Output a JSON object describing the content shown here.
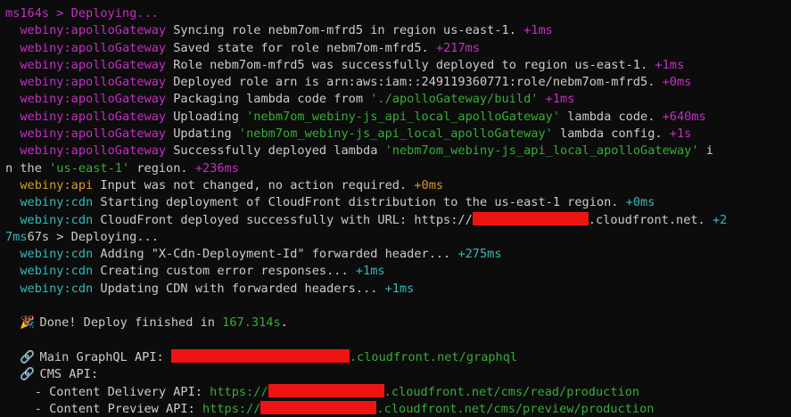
{
  "terminal": {
    "lines": [
      {
        "segments": [
          {
            "text": "ms164s > Deploying...",
            "class": "c-magenta"
          }
        ]
      },
      {
        "segments": [
          {
            "text": "  "
          },
          {
            "text": "webiny:apolloGateway",
            "class": "c-magenta"
          },
          {
            "text": " Syncing role nebm7om-mfrd5 in region us-east-1. ",
            "class": "c-default"
          },
          {
            "text": "+1ms",
            "class": "c-magenta"
          }
        ]
      },
      {
        "segments": [
          {
            "text": "  "
          },
          {
            "text": "webiny:apolloGateway",
            "class": "c-magenta"
          },
          {
            "text": " Saved state for role nebm7om-mfrd5. ",
            "class": "c-default"
          },
          {
            "text": "+217ms",
            "class": "c-magenta"
          }
        ]
      },
      {
        "segments": [
          {
            "text": "  "
          },
          {
            "text": "webiny:apolloGateway",
            "class": "c-magenta"
          },
          {
            "text": " Role nebm7om-mfrd5 was successfully deployed to region us-east-1. ",
            "class": "c-default"
          },
          {
            "text": "+1ms",
            "class": "c-magenta"
          }
        ]
      },
      {
        "segments": [
          {
            "text": "  "
          },
          {
            "text": "webiny:apolloGateway",
            "class": "c-magenta"
          },
          {
            "text": " Deployed role arn is arn:aws:iam::249119360771:role/nebm7om-mfrd5. ",
            "class": "c-default"
          },
          {
            "text": "+0ms",
            "class": "c-magenta"
          }
        ]
      },
      {
        "segments": [
          {
            "text": "  "
          },
          {
            "text": "webiny:apolloGateway",
            "class": "c-magenta"
          },
          {
            "text": " Packaging lambda code from ",
            "class": "c-default"
          },
          {
            "text": "'./apolloGateway/build'",
            "class": "c-green"
          },
          {
            "text": " ",
            "class": "c-default"
          },
          {
            "text": "+1ms",
            "class": "c-magenta"
          }
        ]
      },
      {
        "segments": [
          {
            "text": "  "
          },
          {
            "text": "webiny:apolloGateway",
            "class": "c-magenta"
          },
          {
            "text": " Uploading ",
            "class": "c-default"
          },
          {
            "text": "'nebm7om_webiny-js_api_local_apolloGateway'",
            "class": "c-green"
          },
          {
            "text": " lambda code. ",
            "class": "c-default"
          },
          {
            "text": "+640ms",
            "class": "c-magenta"
          }
        ]
      },
      {
        "segments": [
          {
            "text": "  "
          },
          {
            "text": "webiny:apolloGateway",
            "class": "c-magenta"
          },
          {
            "text": " Updating ",
            "class": "c-default"
          },
          {
            "text": "'nebm7om_webiny-js_api_local_apolloGateway'",
            "class": "c-green"
          },
          {
            "text": " lambda config. ",
            "class": "c-default"
          },
          {
            "text": "+1s",
            "class": "c-magenta"
          }
        ]
      },
      {
        "segments": [
          {
            "text": "  "
          },
          {
            "text": "webiny:apolloGateway",
            "class": "c-magenta"
          },
          {
            "text": " Successfully deployed lambda ",
            "class": "c-default"
          },
          {
            "text": "'nebm7om_webiny-js_api_local_apolloGateway'",
            "class": "c-green"
          },
          {
            "text": " i",
            "class": "c-default"
          }
        ]
      },
      {
        "segments": [
          {
            "text": "n the ",
            "class": "c-default"
          },
          {
            "text": "'us-east-1'",
            "class": "c-green"
          },
          {
            "text": " region. ",
            "class": "c-default"
          },
          {
            "text": "+236ms",
            "class": "c-magenta"
          }
        ]
      },
      {
        "segments": [
          {
            "text": "  "
          },
          {
            "text": "webiny:api",
            "class": "c-orange"
          },
          {
            "text": " Input was not changed, no action required. ",
            "class": "c-default"
          },
          {
            "text": "+0ms",
            "class": "c-orange"
          }
        ]
      },
      {
        "segments": [
          {
            "text": "  "
          },
          {
            "text": "webiny:cdn",
            "class": "c-teal"
          },
          {
            "text": " Starting deployment of CloudFront distribution to the us-east-1 region. ",
            "class": "c-default"
          },
          {
            "text": "+0ms",
            "class": "c-teal"
          }
        ]
      },
      {
        "segments": [
          {
            "text": "  "
          },
          {
            "text": "webiny:cdn",
            "class": "c-teal"
          },
          {
            "text": " CloudFront deployed successfully with URL: https://",
            "class": "c-default"
          },
          {
            "redact": true,
            "width": 130
          },
          {
            "text": ".cloudfront.net. ",
            "class": "c-default"
          },
          {
            "text": "+2",
            "class": "c-teal"
          }
        ]
      },
      {
        "segments": [
          {
            "text": "7ms",
            "class": "c-teal"
          },
          {
            "text": "67s > Deploying...",
            "class": "c-default"
          }
        ]
      },
      {
        "segments": [
          {
            "text": "  "
          },
          {
            "text": "webiny:cdn",
            "class": "c-teal"
          },
          {
            "text": " Adding \"X-Cdn-Deployment-Id\" forwarded header... ",
            "class": "c-default"
          },
          {
            "text": "+275ms",
            "class": "c-teal"
          }
        ]
      },
      {
        "segments": [
          {
            "text": "  "
          },
          {
            "text": "webiny:cdn",
            "class": "c-teal"
          },
          {
            "text": " Creating custom error responses... ",
            "class": "c-default"
          },
          {
            "text": "+1ms",
            "class": "c-teal"
          }
        ]
      },
      {
        "segments": [
          {
            "text": "  "
          },
          {
            "text": "webiny:cdn",
            "class": "c-teal"
          },
          {
            "text": " Updating CDN with forwarded headers... ",
            "class": "c-default"
          },
          {
            "text": "+1ms",
            "class": "c-teal"
          }
        ]
      },
      {
        "segments": []
      },
      {
        "segments": [
          {
            "text": "  "
          },
          {
            "icon": "party-popper-icon",
            "glyph": "🎉"
          },
          {
            "text": " Done! Deploy finished in ",
            "class": "c-default"
          },
          {
            "text": "167.314s",
            "class": "c-green"
          },
          {
            "text": ".",
            "class": "c-default"
          }
        ]
      },
      {
        "segments": []
      },
      {
        "segments": [
          {
            "text": "  "
          },
          {
            "icon": "link-icon",
            "glyph": "🔗"
          },
          {
            "text": " Main GraphQL API: ",
            "class": "c-default"
          },
          {
            "redact": true,
            "width": 200
          },
          {
            "text": ".cloudfront.net/graphql",
            "class": "c-green"
          }
        ]
      },
      {
        "segments": [
          {
            "text": "  "
          },
          {
            "icon": "link-icon",
            "glyph": "🔗"
          },
          {
            "text": " CMS API:",
            "class": "c-default"
          }
        ]
      },
      {
        "segments": [
          {
            "text": "    - Content Delivery API: ",
            "class": "c-default"
          },
          {
            "text": "https://",
            "class": "c-green"
          },
          {
            "redact": true,
            "width": 130
          },
          {
            "text": ".cloudfront.net/cms/read/production",
            "class": "c-green"
          }
        ]
      },
      {
        "segments": [
          {
            "text": "    - Content Preview API: ",
            "class": "c-default"
          },
          {
            "text": "https://",
            "class": "c-green"
          },
          {
            "redact": true,
            "width": 130
          },
          {
            "text": ".cloudfront.net/cms/preview/production",
            "class": "c-green"
          }
        ]
      }
    ]
  },
  "colors": {
    "background": "#0c0c0c",
    "text": "#cccccc",
    "magenta": "#c62ec6",
    "orange": "#d49a2a",
    "teal": "#35b9b9",
    "green": "#37ac37",
    "redaction": "#ee1414"
  }
}
